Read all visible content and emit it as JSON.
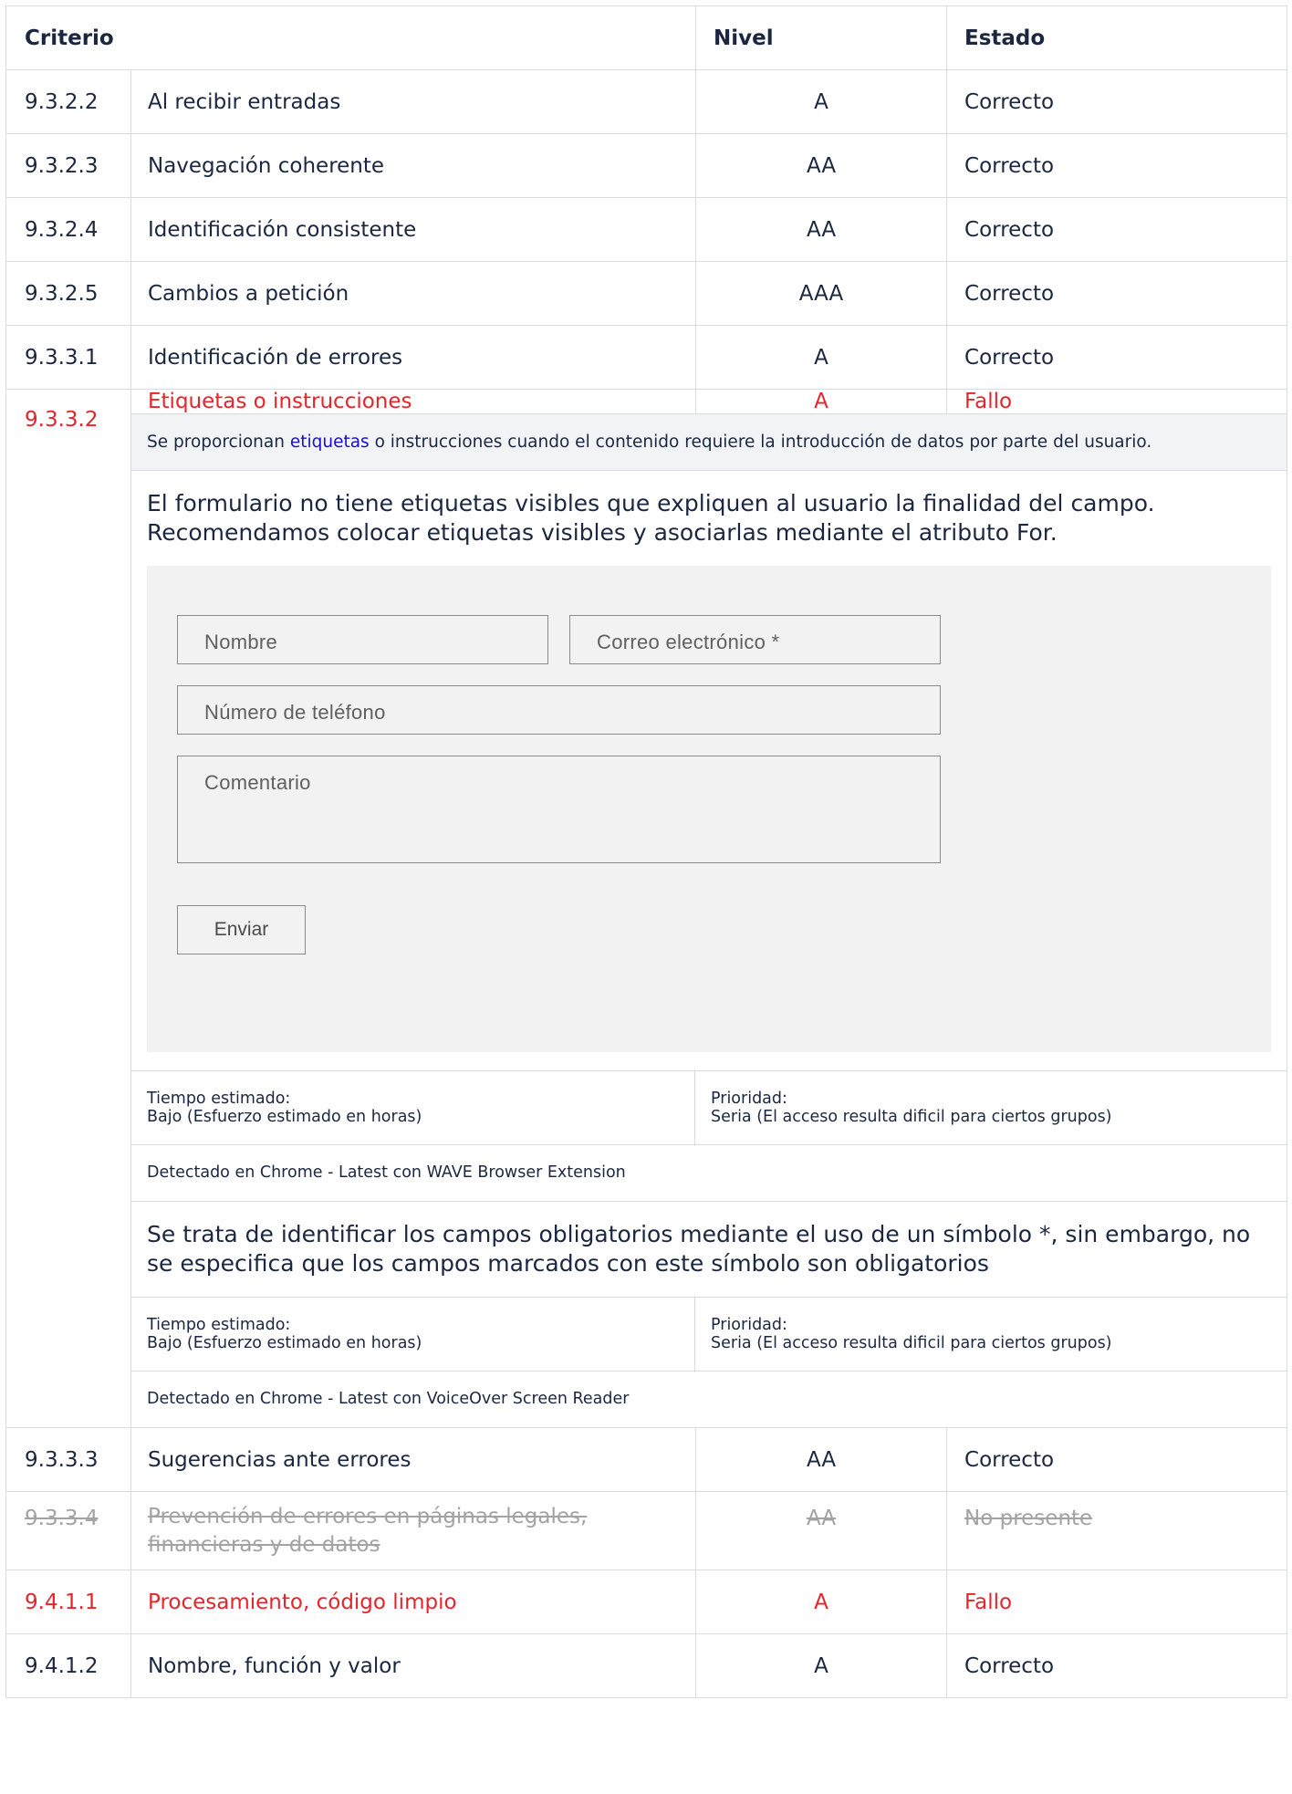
{
  "headers": {
    "criterio": "Criterio",
    "nivel": "Nivel",
    "estado": "Estado"
  },
  "rows_before": [
    {
      "code": "9.3.2.2",
      "name": "Al recibir entradas",
      "level": "A",
      "status": "Correcto"
    },
    {
      "code": "9.3.2.3",
      "name": "Navegación coherente",
      "level": "AA",
      "status": "Correcto"
    },
    {
      "code": "9.3.2.4",
      "name": "Identificación consistente",
      "level": "AA",
      "status": "Correcto"
    },
    {
      "code": "9.3.2.5",
      "name": "Cambios a petición",
      "level": "AAA",
      "status": "Correcto"
    },
    {
      "code": "9.3.3.1",
      "name": "Identificación de errores",
      "level": "A",
      "status": "Correcto"
    }
  ],
  "fail_row": {
    "code": "9.3.3.2",
    "name": "Etiquetas o instrucciones",
    "level": "A",
    "status": "Fallo"
  },
  "fail_details": {
    "summary_prefix": "Se proporcionan ",
    "summary_link": "etiquetas",
    "summary_suffix": " o instrucciones cuando el contenido requiere la introducción de datos por parte del usuario.",
    "issue1": "El formulario no tiene etiquetas visibles que expliquen al usuario la finalidad del campo. Recomendamos colocar etiquetas visibles y asociarlas mediante el atributo For.",
    "form": {
      "nombre": "Nombre",
      "correo": "Correo electrónico *",
      "telefono": "Número de teléfono",
      "comentario": "Comentario",
      "enviar": "Enviar"
    },
    "meta1": {
      "tiempo_label": "Tiempo estimado:",
      "tiempo_value": "Bajo (Esfuerzo estimado en horas)",
      "prioridad_label": "Prioridad:",
      "prioridad_value": "Seria (El acceso resulta dificil para ciertos grupos)"
    },
    "detected1": "Detectado en Chrome - Latest con WAVE Browser Extension",
    "issue2": "Se trata de identificar los campos obligatorios mediante el uso de un símbolo *, sin embargo, no se especifica que los campos marcados con este símbolo son obligatorios",
    "meta2": {
      "tiempo_label": "Tiempo estimado:",
      "tiempo_value": "Bajo (Esfuerzo estimado en horas)",
      "prioridad_label": "Prioridad:",
      "prioridad_value": "Seria (El acceso resulta dificil para ciertos grupos)"
    },
    "detected2": "Detectado en Chrome - Latest con VoiceOver Screen Reader"
  },
  "row_9333": {
    "code": "9.3.3.3",
    "name": "Sugerencias ante errores",
    "level": "AA",
    "status": "Correcto"
  },
  "row_9334": {
    "code": "9.3.3.4",
    "name": "Prevención de errores en páginas legales, financieras y de datos",
    "level": "AA",
    "status": "No presente"
  },
  "row_9411": {
    "code": "9.4.1.1",
    "name": "Procesamiento, código limpio",
    "level": "A",
    "status": "Fallo"
  },
  "row_9412": {
    "code": "9.4.1.2",
    "name": "Nombre, función y valor",
    "level": "A",
    "status": "Correcto"
  },
  "colors": {
    "fail": "#e5242b",
    "not_present": "#a3a3a3",
    "link": "#1a0dcc"
  }
}
